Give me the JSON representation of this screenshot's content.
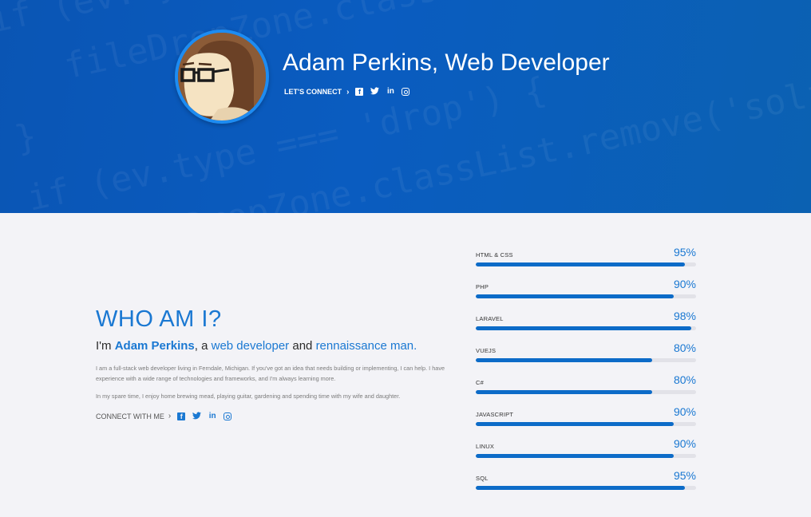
{
  "hero": {
    "title": "Adam Perkins, Web Developer",
    "connect_label": "LET'S CONNECT",
    "background_code": [
      "if (ev.type !== 'click') {",
      "   fileDropZone.classList.add('solid-border');",
      "}",
      "if (ev.type === 'drop') {",
      "   fileDropZone.classList.remove('solid-border');",
      "}"
    ],
    "social": [
      {
        "name": "facebook-icon",
        "glyph": "f"
      },
      {
        "name": "twitter-icon",
        "glyph": "🐦"
      },
      {
        "name": "linkedin-icon",
        "glyph": "in"
      },
      {
        "name": "instagram-icon",
        "glyph": ""
      }
    ]
  },
  "about": {
    "heading": "WHO AM I?",
    "intro_prefix": "I'm ",
    "name": "Adam Perkins",
    "sep1": ", a ",
    "role1": "web developer",
    "sep2": " and ",
    "role2": "rennaissance man.",
    "paragraph1": "I am a full-stack web developer living in Ferndale, Michigan. If you've got an idea that needs building or implementing, I can help. I have experience with a wide range of technologies and frameworks, and I'm always learning more.",
    "paragraph2": "In my spare time, I enjoy home brewing mead, playing guitar, gardening and spending time with my wife and daughter.",
    "connect_label": "CONNECT WITH ME"
  },
  "skills": [
    {
      "name": "HTML & CSS",
      "percent_label": "95%",
      "value": 95
    },
    {
      "name": "PHP",
      "percent_label": "90%",
      "value": 90
    },
    {
      "name": "LARAVEL",
      "percent_label": "98%",
      "value": 98
    },
    {
      "name": "VUEJS",
      "percent_label": "80%",
      "value": 80
    },
    {
      "name": "C#",
      "percent_label": "80%",
      "value": 80
    },
    {
      "name": "JAVASCRIPT",
      "percent_label": "90%",
      "value": 90
    },
    {
      "name": "LINUX",
      "percent_label": "90%",
      "value": 90
    },
    {
      "name": "SQL",
      "percent_label": "95%",
      "value": 95
    }
  ],
  "colors": {
    "accent": "#1a78d2",
    "hero_background": "#0a5cbd",
    "bar_fill": "#0c6bc8",
    "bar_track": "#e2e2e8"
  }
}
